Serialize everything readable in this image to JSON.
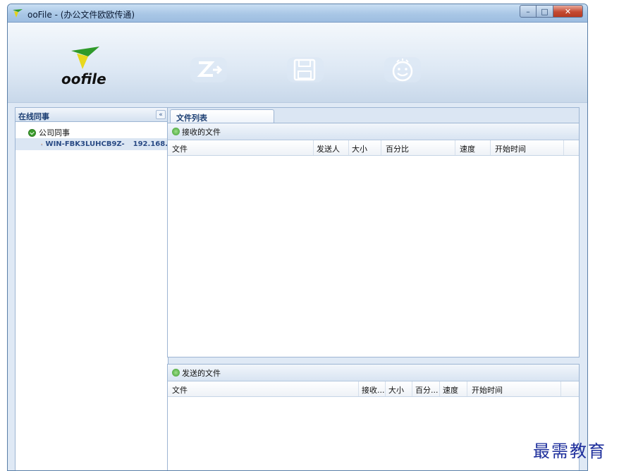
{
  "window": {
    "title": "ooFile - (办公文件欧欧传通)"
  },
  "banner": {
    "brand": "oofile",
    "toolbar_icons": [
      "transfer-icon",
      "save-icon",
      "smiley-icon"
    ]
  },
  "sidebar": {
    "title": "在线同事",
    "collapse_label": "«",
    "group": "公司同事",
    "users": [
      {
        "name": "WIN-FBK3LUHCB9Z-",
        "ip": "192.168."
      }
    ]
  },
  "main": {
    "tab_label": "文件列表",
    "received": {
      "title": "接收的文件",
      "columns": [
        "文件",
        "发送人",
        "大小",
        "百分比",
        "速度",
        "开始时间"
      ]
    },
    "sent": {
      "title": "发送的文件",
      "columns": [
        "文件",
        "接收...",
        "大小",
        "百分...",
        "速度",
        "开始时间"
      ]
    }
  },
  "watermark": "最需教育",
  "colors": {
    "accent": "#1c3f73",
    "border": "#9db5d3",
    "selection": "#dbe6f3"
  }
}
